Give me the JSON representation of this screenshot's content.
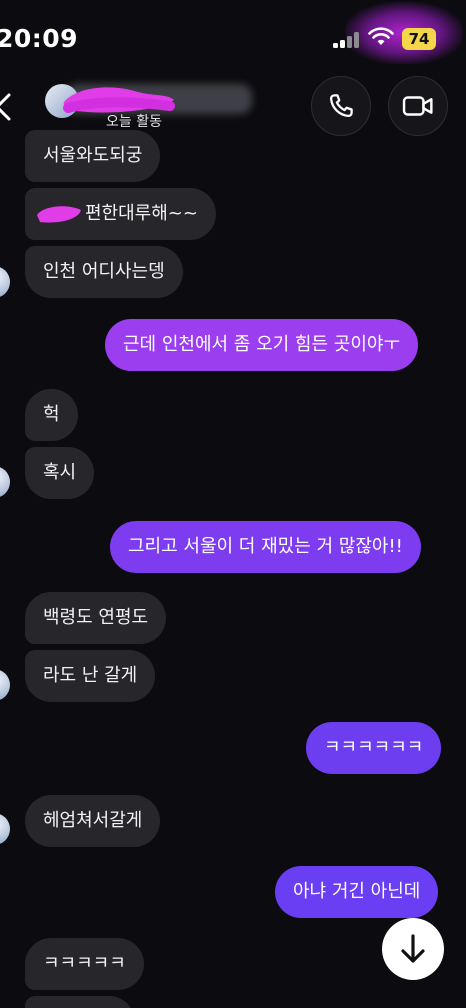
{
  "status_bar": {
    "time": "20:09",
    "battery": "74"
  },
  "header": {
    "status": "오늘 활동",
    "icons": [
      "back-arrow-icon",
      "phone-icon",
      "video-camera-icon"
    ]
  },
  "messages": [
    {
      "side": "in",
      "text": "서울와도되궁"
    },
    {
      "side": "in",
      "text": "편한대루해~~"
    },
    {
      "side": "in",
      "text": "인천 어디사는뎅"
    },
    {
      "side": "out",
      "text": "근데 인천에서 좀 오기 힘든 곳이야ㅜ"
    },
    {
      "side": "in",
      "text": "헉"
    },
    {
      "side": "in",
      "text": "혹시"
    },
    {
      "side": "out",
      "text": "그리고 서울이 더 재밌는 거 많잖아!!"
    },
    {
      "side": "in",
      "text": "백령도 연평도"
    },
    {
      "side": "in",
      "text": "라도 난 갈게"
    },
    {
      "side": "out",
      "text": "ㅋㅋㅋㅋㅋㅋ"
    },
    {
      "side": "in",
      "text": "헤엄쳐서갈게"
    },
    {
      "side": "out",
      "text": "아냐 거긴 아닌데"
    },
    {
      "side": "in",
      "text": "ㅋㅋㅋㅋㅋ"
    }
  ],
  "colors": {
    "incoming_bubble": "#26262b",
    "outgoing_top": "#a640e8",
    "outgoing_bottom": "#6d3df0",
    "background": "#0c0c10"
  }
}
